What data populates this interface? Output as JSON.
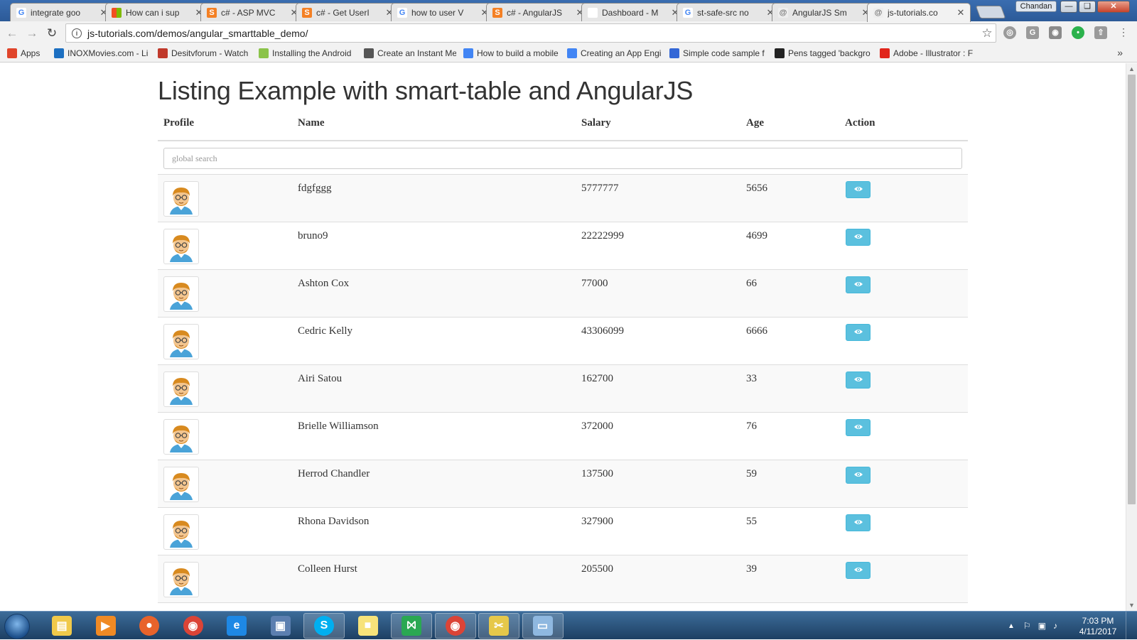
{
  "browser": {
    "tabs": [
      {
        "title": "integrate goo",
        "favicon": "google-icon"
      },
      {
        "title": "How can i sup",
        "favicon": "microsoft-icon"
      },
      {
        "title": "c# - ASP MVC",
        "favicon": "stackoverflow-icon"
      },
      {
        "title": "c# - Get UserI",
        "favicon": "stackoverflow-icon"
      },
      {
        "title": "how to user V",
        "favicon": "google-icon"
      },
      {
        "title": "c# - AngularJS",
        "favicon": "stackoverflow-icon"
      },
      {
        "title": "Dashboard - M",
        "favicon": "page-icon"
      },
      {
        "title": "st-safe-src no",
        "favicon": "google-icon"
      },
      {
        "title": "AngularJS Sm",
        "favicon": "site-icon"
      },
      {
        "title": "js-tutorials.co",
        "favicon": "site-icon",
        "active": true
      }
    ],
    "profile_name": "Chandan",
    "url": "js-tutorials.com/demos/angular_smarttable_demo/",
    "bookmarks": [
      {
        "label": "Apps",
        "icon": "apps-grid-icon",
        "color": "#e0452b"
      },
      {
        "label": "INOXMovies.com - Li",
        "icon": "inox-icon",
        "color": "#1c6fc1"
      },
      {
        "label": "Desitvforum - Watch",
        "icon": "desitv-icon",
        "color": "#c0392b"
      },
      {
        "label": "Installing the Android",
        "icon": "android-icon",
        "color": "#8bc34a"
      },
      {
        "label": "Create an Instant Mes",
        "icon": "page-icon",
        "color": "#555555"
      },
      {
        "label": "How to build a mobile",
        "icon": "google-icon",
        "color": "#4285f4"
      },
      {
        "label": "Creating an App Engi",
        "icon": "appengine-icon",
        "color": "#4285f4"
      },
      {
        "label": "Simple code sample f",
        "icon": "grid-icon",
        "color": "#3367d6"
      },
      {
        "label": "Pens tagged 'backgro",
        "icon": "codepen-icon",
        "color": "#222222"
      },
      {
        "label": "Adobe - Illustrator : F",
        "icon": "adobe-icon",
        "color": "#e1251b"
      }
    ]
  },
  "page": {
    "title": "Listing Example with smart-table and AngularJS",
    "columns": [
      "Profile",
      "Name",
      "Salary",
      "Age",
      "Action"
    ],
    "search_placeholder": "global search",
    "rows": [
      {
        "name": "fdgfggg",
        "salary": "5777777",
        "age": "5656"
      },
      {
        "name": "bruno9",
        "salary": "22222999",
        "age": "4699"
      },
      {
        "name": "Ashton Cox",
        "salary": "77000",
        "age": "66"
      },
      {
        "name": "Cedric Kelly",
        "salary": "43306099",
        "age": "6666"
      },
      {
        "name": "Airi Satou",
        "salary": "162700",
        "age": "33"
      },
      {
        "name": "Brielle Williamson",
        "salary": "372000",
        "age": "76"
      },
      {
        "name": "Herrod Chandler",
        "salary": "137500",
        "age": "59"
      },
      {
        "name": "Rhona Davidson",
        "salary": "327900",
        "age": "55"
      },
      {
        "name": "Colleen Hurst",
        "salary": "205500",
        "age": "39"
      }
    ],
    "accent_color": "#5bc0de"
  },
  "taskbar": {
    "apps": [
      "explorer-icon",
      "media-player-icon",
      "firefox-icon",
      "chrome-icon",
      "internet-explorer-icon",
      "network-manager-icon",
      "skype-icon",
      "sticky-notes-icon",
      "visual-studio-icon",
      "chrome-icon",
      "snipping-tool-icon",
      "notepad-icon"
    ],
    "time": "7:03 PM",
    "date": "4/11/2017"
  }
}
